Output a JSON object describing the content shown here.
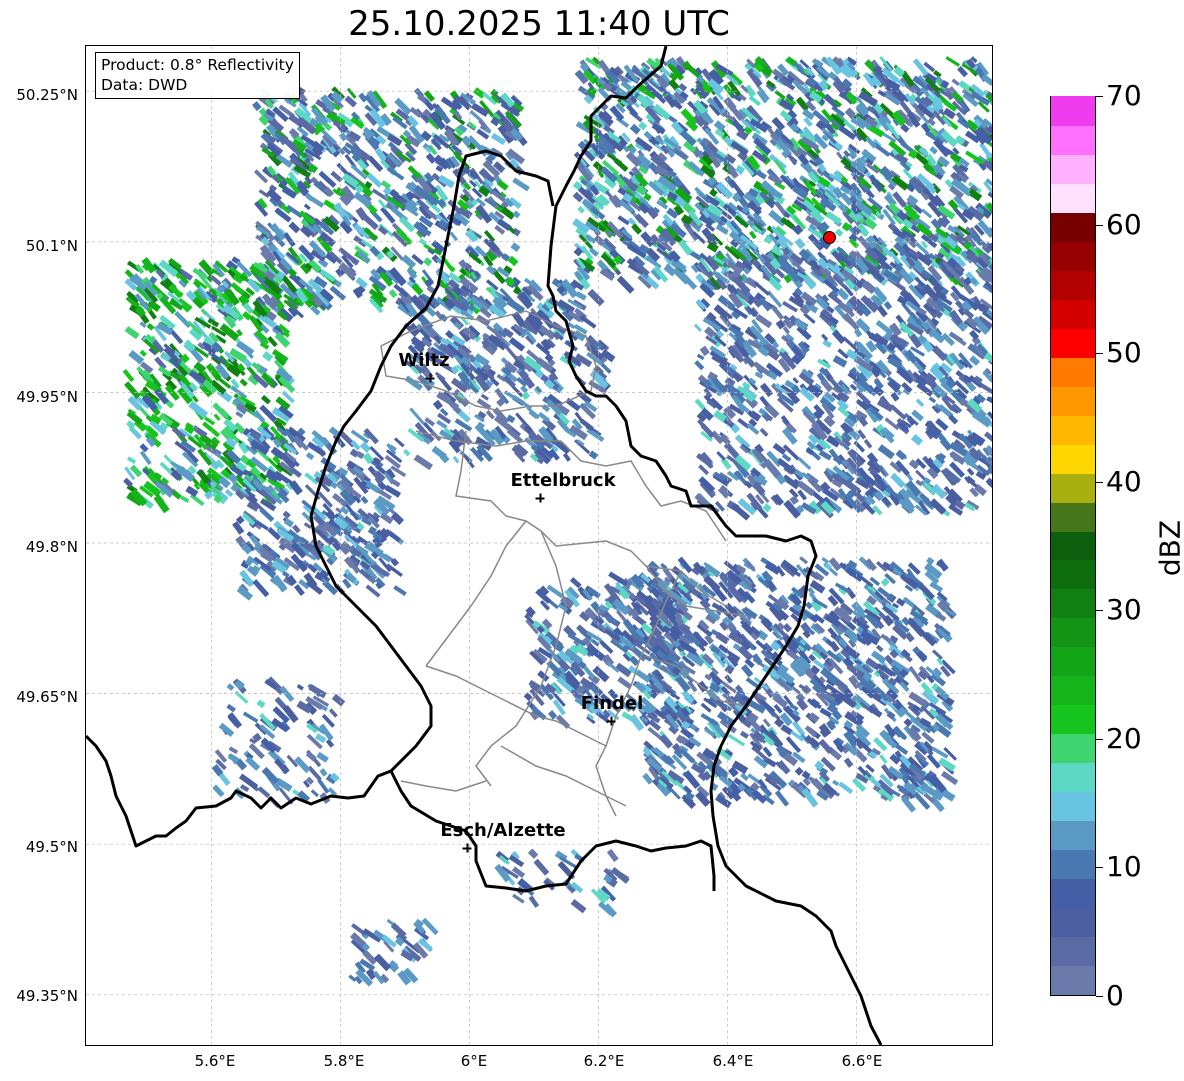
{
  "title": "25.10.2025 11:40 UTC",
  "infobox": {
    "product": "Product: 0.8° Reflectivity",
    "data": "Data: DWD"
  },
  "map": {
    "lat_range": [
      49.3,
      50.295
    ],
    "lon_range": [
      5.405,
      6.81
    ],
    "lat_ticks": [
      {
        "value": 50.25,
        "label": "50.25°N"
      },
      {
        "value": 50.1,
        "label": "50.1°N"
      },
      {
        "value": 49.95,
        "label": "49.95°N"
      },
      {
        "value": 49.8,
        "label": "49.8°N"
      },
      {
        "value": 49.65,
        "label": "49.65°N"
      },
      {
        "value": 49.5,
        "label": "49.5°N"
      },
      {
        "value": 49.35,
        "label": "49.35°N"
      }
    ],
    "lon_ticks": [
      {
        "value": 5.6,
        "label": "5.6°E"
      },
      {
        "value": 5.8,
        "label": "5.8°E"
      },
      {
        "value": 6.0,
        "label": "6°E"
      },
      {
        "value": 6.2,
        "label": "6.2°E"
      },
      {
        "value": 6.4,
        "label": "6.4°E"
      },
      {
        "value": 6.6,
        "label": "6.6°E"
      }
    ],
    "cities": [
      {
        "name": "Wiltz",
        "lat": 49.967,
        "lon": 5.932
      },
      {
        "name": "Ettelbruck",
        "lat": 49.847,
        "lon": 6.104
      },
      {
        "name": "Findel",
        "lat": 49.627,
        "lon": 6.213
      },
      {
        "name": "Esch/Alzette",
        "lat": 49.498,
        "lon": 5.988
      }
    ],
    "radar_site": {
      "lat": 50.11,
      "lon": 6.548
    },
    "grid": true
  },
  "colorbar": {
    "label": "dBZ",
    "min": 0,
    "max": 70,
    "step": 2.5,
    "ticks": [
      0,
      10,
      20,
      30,
      40,
      50,
      60,
      70
    ],
    "colors": [
      "#6a7aaa",
      "#5a6aa5",
      "#4a5ea0",
      "#445fa5",
      "#4a78b0",
      "#5a9ac5",
      "#68c4e0",
      "#5dd8c5",
      "#3ed470",
      "#16c41e",
      "#14b41a",
      "#14a418",
      "#149414",
      "#118012",
      "#0e6e0e",
      "#0d5f0d",
      "#46761a",
      "#aaaf10",
      "#ffd700",
      "#ffb800",
      "#ff9800",
      "#ff7b00",
      "#ff0000",
      "#d40000",
      "#b30000",
      "#960000",
      "#780000",
      "#ffe0ff",
      "#ffb0ff",
      "#ff70ff",
      "#ee3cee"
    ]
  }
}
